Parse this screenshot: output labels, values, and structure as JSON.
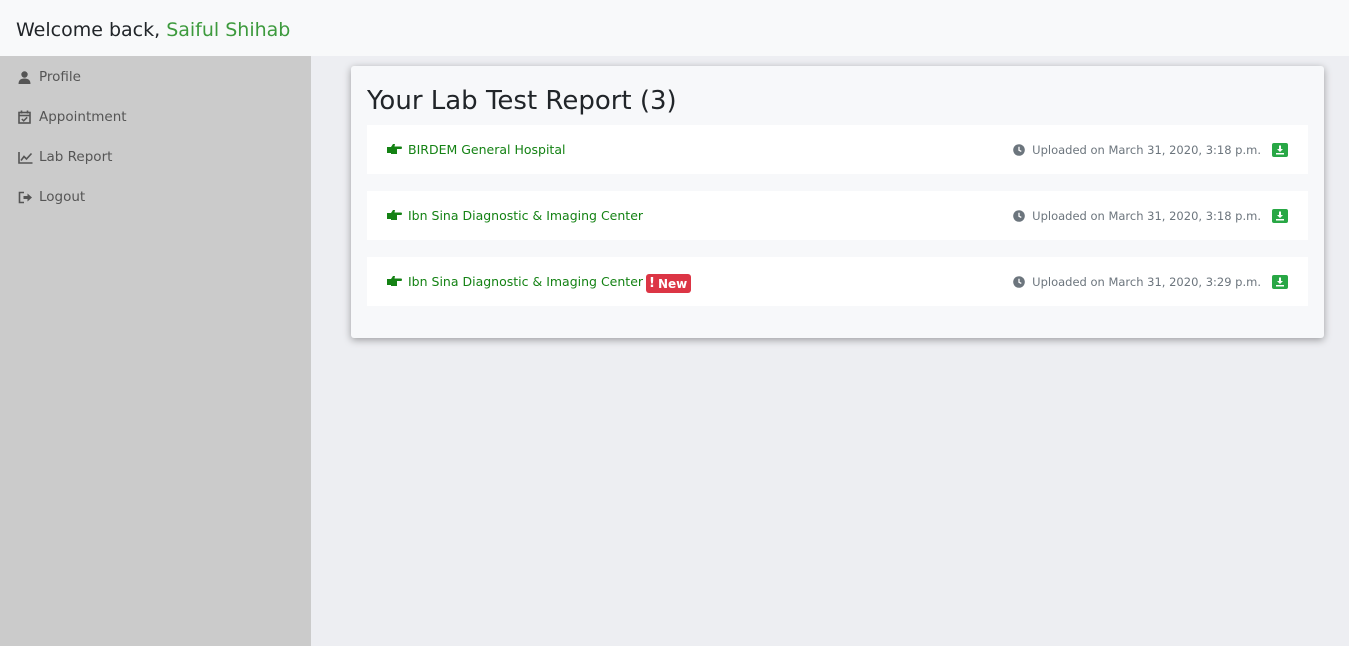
{
  "header": {
    "welcome_prefix": "Welcome back,",
    "user_name": "Saiful Shihab"
  },
  "sidebar": {
    "items": [
      {
        "label": "Profile",
        "icon": "user-icon"
      },
      {
        "label": "Appointment",
        "icon": "calendar-check-icon"
      },
      {
        "label": "Lab Report",
        "icon": "chart-line-icon"
      },
      {
        "label": "Logout",
        "icon": "sign-out-icon"
      }
    ]
  },
  "main": {
    "title": "Your Lab Test Report (3)",
    "reports": [
      {
        "lab": "BIRDEM General Hospital",
        "uploaded": "Uploaded on March 31, 2020, 3:18 p.m.",
        "badge": ""
      },
      {
        "lab": "Ibn Sina Diagnostic & Imaging Center",
        "uploaded": "Uploaded on March 31, 2020, 3:18 p.m.",
        "badge": ""
      },
      {
        "lab": "Ibn Sina Diagnostic & Imaging Center",
        "uploaded": "Uploaded on March 31, 2020, 3:29 p.m.",
        "badge": "New"
      }
    ]
  },
  "colors": {
    "accent_green": "#148214",
    "badge_red": "#dc3545",
    "download_green": "#28a745",
    "sidebar_bg": "#cbcbcb"
  }
}
